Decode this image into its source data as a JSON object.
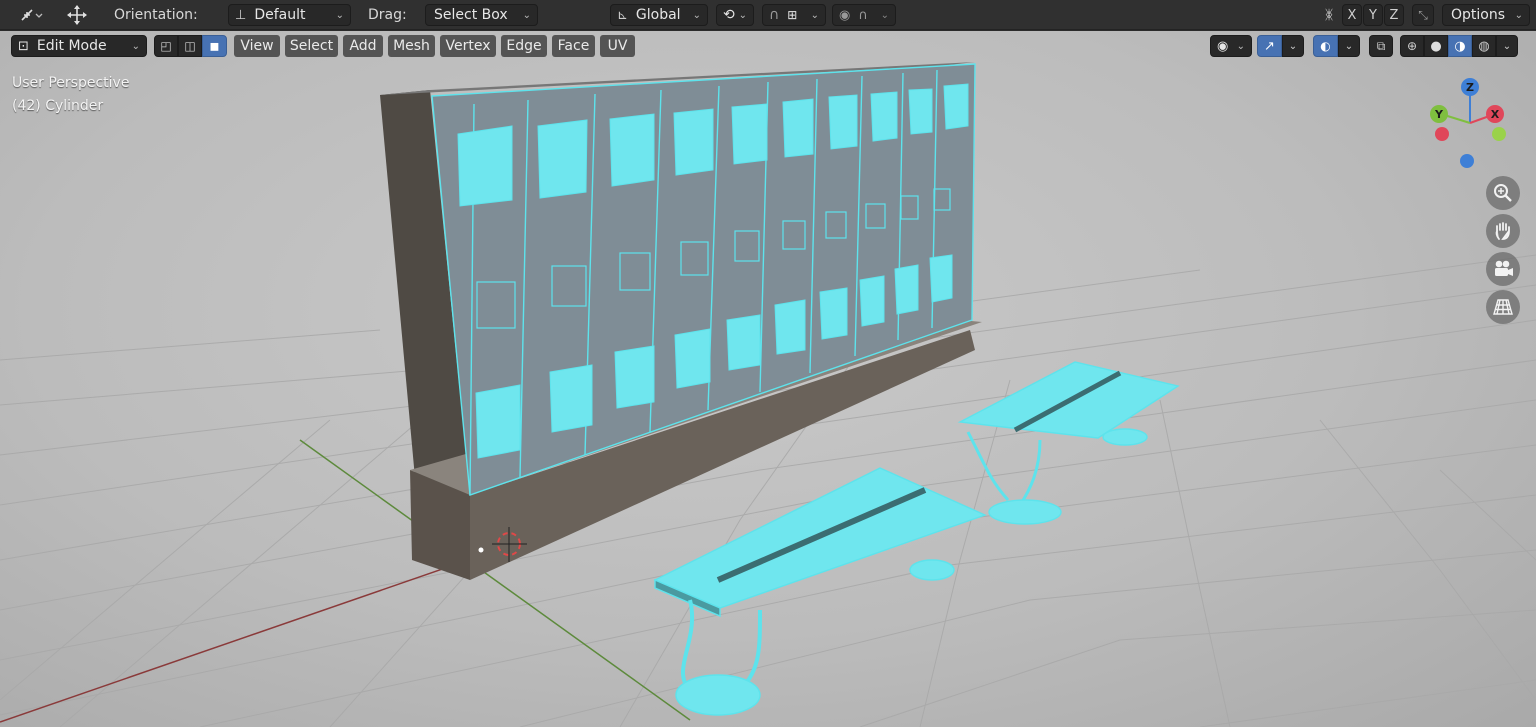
{
  "toolbar": {
    "orientation_label": "Orientation:",
    "orientation_value": "Default",
    "drag_label": "Drag:",
    "drag_value": "Select Box",
    "transform_space": "Global",
    "axis_x": "X",
    "axis_y": "Y",
    "axis_z": "Z",
    "options_label": "Options"
  },
  "header": {
    "mode": "Edit Mode",
    "menus": [
      "View",
      "Select",
      "Add",
      "Mesh",
      "Vertex",
      "Edge",
      "Face",
      "UV"
    ]
  },
  "viewport": {
    "perspective_label": "User Perspective",
    "object_label": "(42) Cylinder"
  },
  "gizmo": {
    "axis_z": "Z",
    "axis_y": "Y",
    "axis_x": "X",
    "colors": {
      "x": "#e0475a",
      "y": "#7fbf3f",
      "z": "#3e7fd6",
      "selected": "#5ad8e6",
      "accent": "#4772b3"
    }
  },
  "icons": {
    "editor_type": "transform-gizmo-icon",
    "move": "move-arrows-icon",
    "snap": "snap-magnet-icon",
    "proportional": "proportional-edit-icon",
    "zoom": "zoom-icon",
    "hand": "hand-pan-icon",
    "camera": "camera-icon",
    "grid": "perspective-grid-icon"
  }
}
